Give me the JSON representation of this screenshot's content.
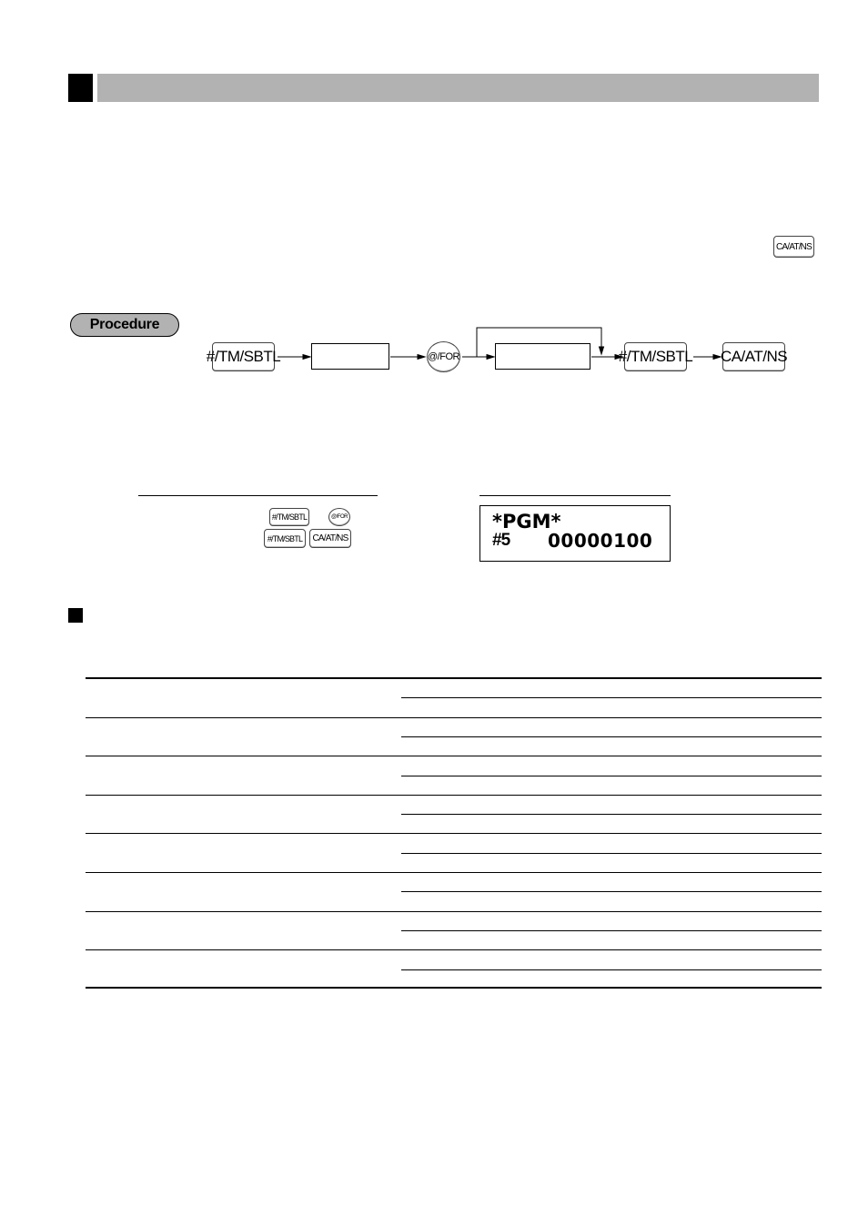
{
  "section_header": {
    "title": ""
  },
  "inline_key": {
    "label": "CA/AT/NS"
  },
  "procedure": {
    "badge_label": "Procedure",
    "flow": [
      {
        "type": "key",
        "label": "#/TM/SBTL"
      },
      {
        "type": "input-box",
        "label": ""
      },
      {
        "type": "key-round",
        "label": "@/FOR"
      },
      {
        "type": "input-box-repeat",
        "label": ""
      },
      {
        "type": "key",
        "label": "#/TM/SBTL"
      },
      {
        "type": "key",
        "label": "CA/AT/NS"
      }
    ]
  },
  "example": {
    "key_operation": {
      "row1": [
        "#/TM/SBTL",
        "@/FOR"
      ],
      "row2": [
        "#/TM/SBTL",
        "CA/AT/NS"
      ]
    },
    "display": {
      "line1": "*PGM*",
      "line2_code": "#5",
      "line2_value": "00000100"
    }
  },
  "subsection": {
    "title": ""
  },
  "table": {
    "rows": [
      {
        "label": "",
        "options": [
          "",
          ""
        ]
      },
      {
        "label": "",
        "options": [
          "",
          ""
        ]
      },
      {
        "label": "",
        "options": [
          "",
          ""
        ]
      },
      {
        "label": "",
        "options": [
          "",
          ""
        ]
      },
      {
        "label": "",
        "options": [
          "",
          ""
        ]
      },
      {
        "label": "",
        "options": [
          "",
          ""
        ]
      },
      {
        "label": "",
        "options": [
          "",
          ""
        ]
      },
      {
        "label": "",
        "options": [
          "",
          ""
        ]
      }
    ]
  }
}
